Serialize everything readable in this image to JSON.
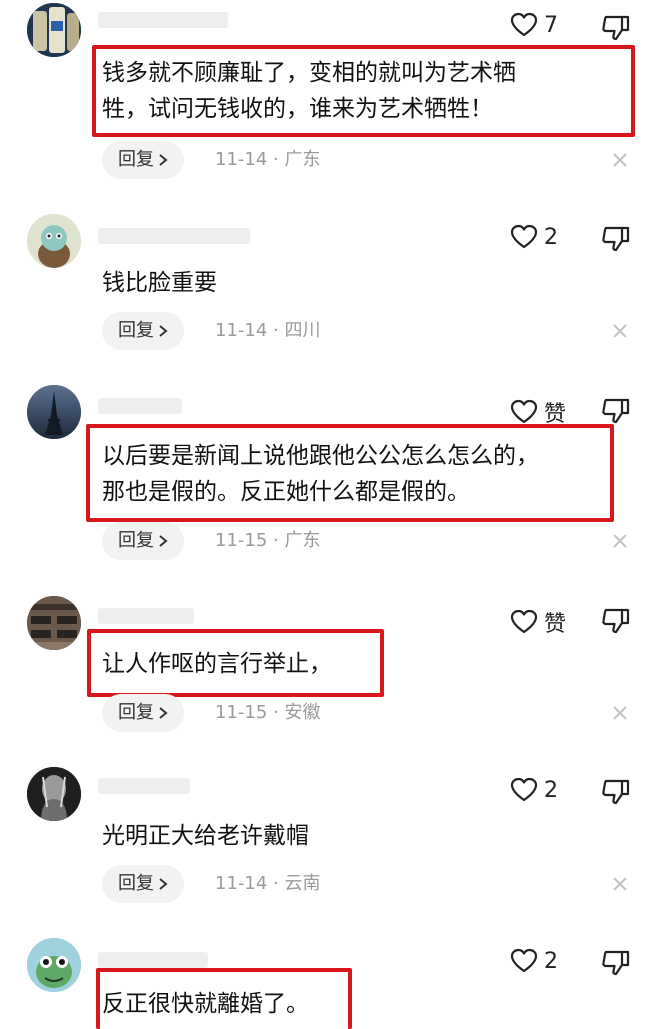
{
  "reply_label": "回复",
  "comments": [
    {
      "text_lines": [
        "钱多就不顾廉耻了，变相的就叫为艺术牺",
        "牲，试问无钱收的，谁来为艺术牺牲！"
      ],
      "likes": "7",
      "date": "11-14",
      "region": "广东",
      "avatar": "beer-can-avatar"
    },
    {
      "text_lines": [
        "钱比脸重要"
      ],
      "likes": "2",
      "date": "11-14",
      "region": "四川",
      "avatar": "cartoon-frog-avatar"
    },
    {
      "text_lines": [
        "以后要是新闻上说他跟他公公怎么怎么的，",
        "那也是假的。反正她什么都是假的。"
      ],
      "likes": "赞",
      "date": "11-15",
      "region": "广东",
      "avatar": "eiffel-tower-avatar"
    },
    {
      "text_lines": [
        "让人作呕的言行举止，"
      ],
      "likes": "赞",
      "date": "11-15",
      "region": "安徽",
      "avatar": "classroom-avatar"
    },
    {
      "text_lines": [
        "光明正大给老许戴帽"
      ],
      "likes": "2",
      "date": "11-14",
      "region": "云南",
      "avatar": "dark-figure-avatar"
    },
    {
      "text_lines": [
        "反正很快就離婚了。"
      ],
      "likes": "2",
      "date": "",
      "region": "",
      "avatar": "green-frog-avatar"
    }
  ]
}
